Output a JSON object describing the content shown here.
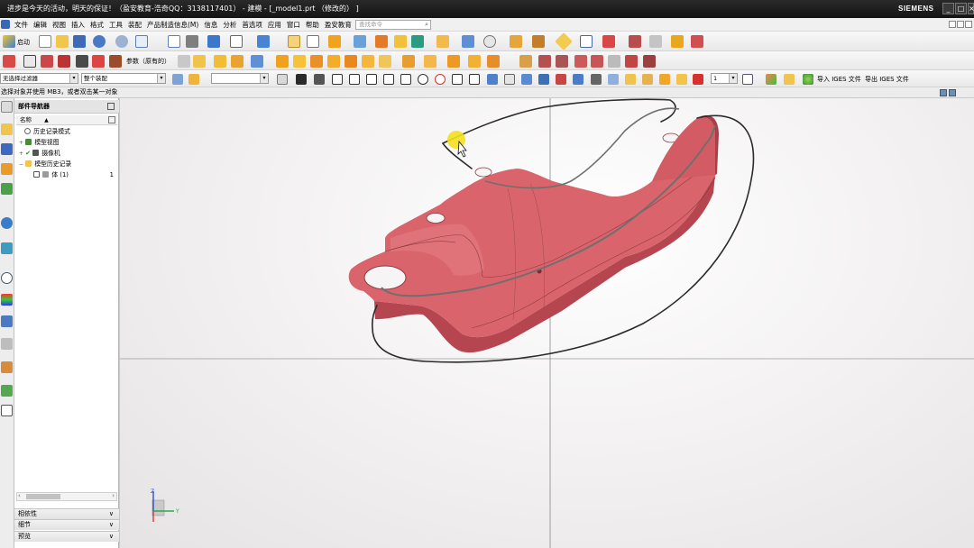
{
  "window": {
    "title": "进步是今天的活动，明天的保证！（盈安教育-浩奇QQ：3138117401） - 建模 - [_model1.prt （修改的） ]",
    "brand": "SIEMENS",
    "controls": [
      "_",
      "□",
      "×"
    ]
  },
  "menubar": {
    "items": [
      "文件",
      "编辑",
      "视图",
      "插入",
      "格式",
      "工具",
      "装配",
      "产品制造信息(M)",
      "信息",
      "分析",
      "首选项",
      "应用",
      "窗口",
      "帮助",
      "盈安教育"
    ],
    "search_placeholder": "查找命令"
  },
  "toolbar1": {
    "start_label": "启动"
  },
  "toolbar2": {
    "params_label": "参数（原有的）"
  },
  "toolbar3": {
    "filter_value": "无选择过滤器",
    "assembly_value": "整个装配",
    "layer_value": "1",
    "import_iges": "导入 IGES 文件",
    "export_iges": "导出 IGES 文件"
  },
  "cue": {
    "text": "选择对象并使用 MB3，或者双击某一对象"
  },
  "navigator": {
    "title": "部件导航器",
    "column_name": "名称",
    "items": [
      {
        "label": "历史记录模式",
        "count": ""
      },
      {
        "label": "模型视图",
        "count": ""
      },
      {
        "label": "摄像机",
        "count": ""
      },
      {
        "label": "模型历史记录",
        "count": ""
      },
      {
        "label": "体 (1)",
        "count": "1"
      }
    ],
    "sections": [
      "相依性",
      "细节",
      "预览"
    ]
  },
  "viewport": {
    "triad": {
      "x_label": "Y",
      "z_label": "Z"
    },
    "part_color": "#d9646c",
    "sketch_color": "#2a2a2a",
    "highlight_color": "#f3df1e"
  }
}
